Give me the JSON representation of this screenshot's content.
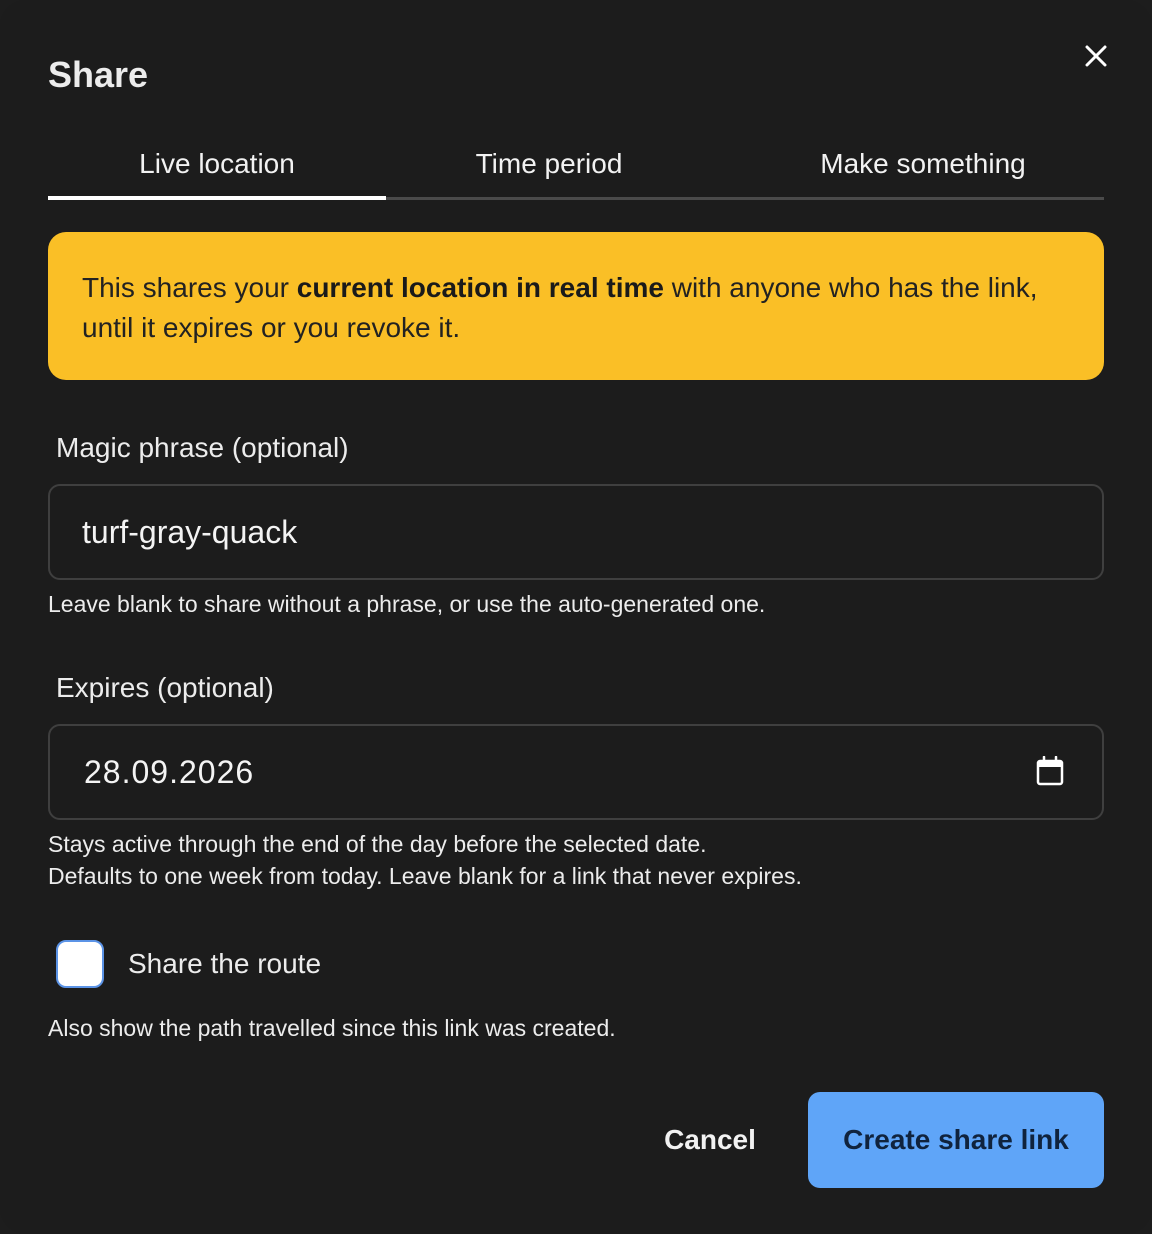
{
  "dialog": {
    "title": "Share",
    "close_icon": "close-icon"
  },
  "tabs": [
    {
      "label": "Live location",
      "active": true
    },
    {
      "label": "Time period",
      "active": false
    },
    {
      "label": "Make something",
      "active": false
    }
  ],
  "notice": {
    "text_before": "This shares your ",
    "text_bold": "current location in real time",
    "text_after": " with anyone who has the link, until it expires or you revoke it.",
    "background_color": "#fabf26"
  },
  "magic_phrase": {
    "label": "Magic phrase (optional)",
    "value": "turf-gray-quack",
    "hint": "Leave blank to share without a phrase, or use the auto-generated one."
  },
  "expires": {
    "label": "Expires (optional)",
    "value": "28.09.2026",
    "calendar_icon": "calendar-icon",
    "hint_line1": "Stays active through the end of the day before the selected date.",
    "hint_line2": "Defaults to one week from today. Leave blank for a link that never expires."
  },
  "share_route": {
    "label": "Share the route",
    "checked": false,
    "hint": "Also show the path travelled since this link was created."
  },
  "actions": {
    "cancel_label": "Cancel",
    "create_label": "Create share link",
    "primary_color": "#5fa5f8"
  }
}
